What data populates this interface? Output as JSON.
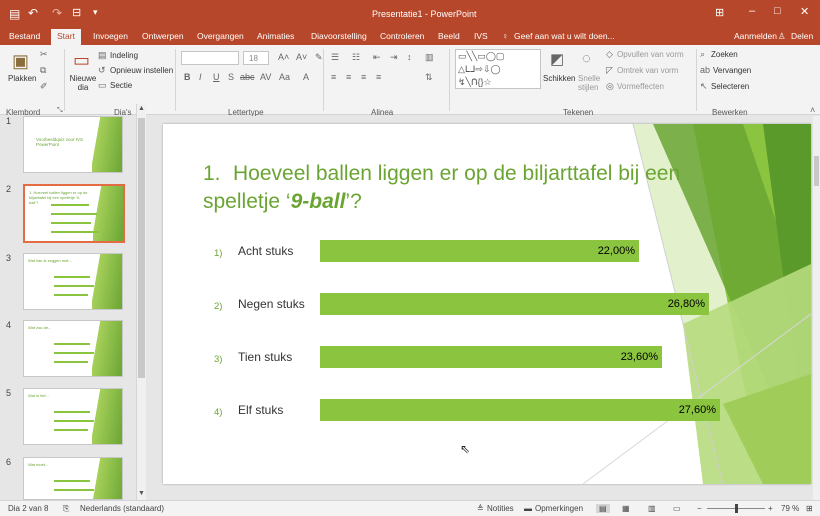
{
  "titlebar": {
    "title": "Presentatie1 - PowerPoint"
  },
  "tabs": [
    "Bestand",
    "Start",
    "Invoegen",
    "Ontwerpen",
    "Overgangen",
    "Animaties",
    "Diavoorstelling",
    "Controleren",
    "Beeld",
    "IVS"
  ],
  "active_tab": "Start",
  "tellme": "Geef aan wat u wilt doen...",
  "account": {
    "signin": "Aanmelden",
    "share": "Delen"
  },
  "ribbon": {
    "groups": [
      "Klembord",
      "Dia's",
      "Lettertype",
      "Alinea",
      "Tekenen",
      "Bewerken"
    ],
    "paste": "Plakken",
    "new_slide": "Nieuwe dia",
    "layout": "Indeling",
    "reset": "Opnieuw instellen",
    "section": "Sectie",
    "font_size": "18",
    "arrange": "Schikken",
    "quick_styles": "Snelle stijlen",
    "fill": "Opvullen van vorm",
    "outline": "Omtrek van vorm",
    "effects": "Vormeffecten",
    "find": "Zoeken",
    "replace": "Vervangen",
    "select": "Selecteren"
  },
  "thumbnails": [
    {
      "num": "1",
      "title": "Voorbeeldquiz voor IVS PowerPoint"
    },
    {
      "num": "2",
      "title": "1. Hoeveel ballen liggen er op de biljarttafel bij een spelletje '9-ball'?"
    },
    {
      "num": "3",
      "title": "Wat kan ik zeggen met..."
    },
    {
      "num": "4",
      "title": "Wat zou de..."
    },
    {
      "num": "5",
      "title": "Wat is het..."
    },
    {
      "num": "6",
      "title": "Wat moet..."
    }
  ],
  "slide": {
    "title_num": "1.",
    "title_pre": "Hoeveel ballen liggen er op de biljarttafel bij een spelletje ‘",
    "title_em": "9-ball",
    "title_post": "’?",
    "options": [
      {
        "num": "1)",
        "label": "Acht stuks",
        "pct": "22,00%",
        "value": 22.0
      },
      {
        "num": "2)",
        "label": "Negen stuks",
        "pct": "26,80%",
        "value": 26.8
      },
      {
        "num": "3)",
        "label": "Tien stuks",
        "pct": "23,60%",
        "value": 23.6
      },
      {
        "num": "4)",
        "label": "Elf stuks",
        "pct": "27,60%",
        "value": 27.6
      }
    ]
  },
  "status": {
    "slide": "Dia 2 van 8",
    "lang": "Nederlands (standaard)",
    "notes": "Notities",
    "comments": "Opmerkingen",
    "zoom": "79 %"
  },
  "colors": {
    "accent": "#b7472a",
    "green": "#8bc53f",
    "title_green": "#6aa533"
  }
}
